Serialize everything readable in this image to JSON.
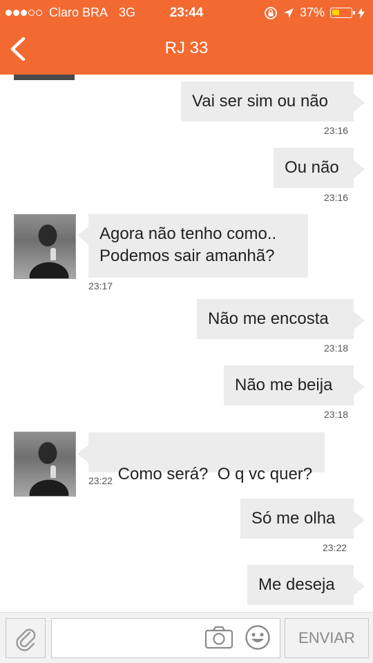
{
  "status_bar": {
    "carrier": "Claro BRA",
    "network": "3G",
    "time": "23:44",
    "battery_percent": "37%",
    "battery_level": 0.37,
    "signal_bars": 3,
    "icons": [
      "signal-dots",
      "rotation-lock-icon",
      "location-arrow-icon",
      "battery-icon",
      "charging-bolt-icon"
    ]
  },
  "header": {
    "title": "RJ 33",
    "back_icon": "chevron-left-icon",
    "accent_color": "#f26a32"
  },
  "messages": [
    {
      "direction": "out",
      "text": "Vai ser sim ou não",
      "time": "23:16"
    },
    {
      "direction": "out",
      "text": "Ou não",
      "time": "23:16"
    },
    {
      "direction": "in",
      "text": "Agora não tenho como..\nPodemos sair amanhã?",
      "line1": "Agora não tenho como..",
      "line2": "Podemos sair amanhã?",
      "time": "23:17"
    },
    {
      "direction": "out",
      "text": "Não me encosta",
      "time": "23:18"
    },
    {
      "direction": "out",
      "text": "Não me beija",
      "time": "23:18"
    },
    {
      "direction": "in",
      "text": "Como será?  O q vc quer?",
      "time": "23:22"
    },
    {
      "direction": "out",
      "text": "Só me olha",
      "time": "23:22"
    },
    {
      "direction": "out",
      "text": "Me deseja",
      "time": ""
    }
  ],
  "input_bar": {
    "attach_icon": "paperclip-icon",
    "camera_icon": "camera-icon",
    "emoji_icon": "smiley-icon",
    "send_label": "ENVIAR",
    "text_value": ""
  }
}
